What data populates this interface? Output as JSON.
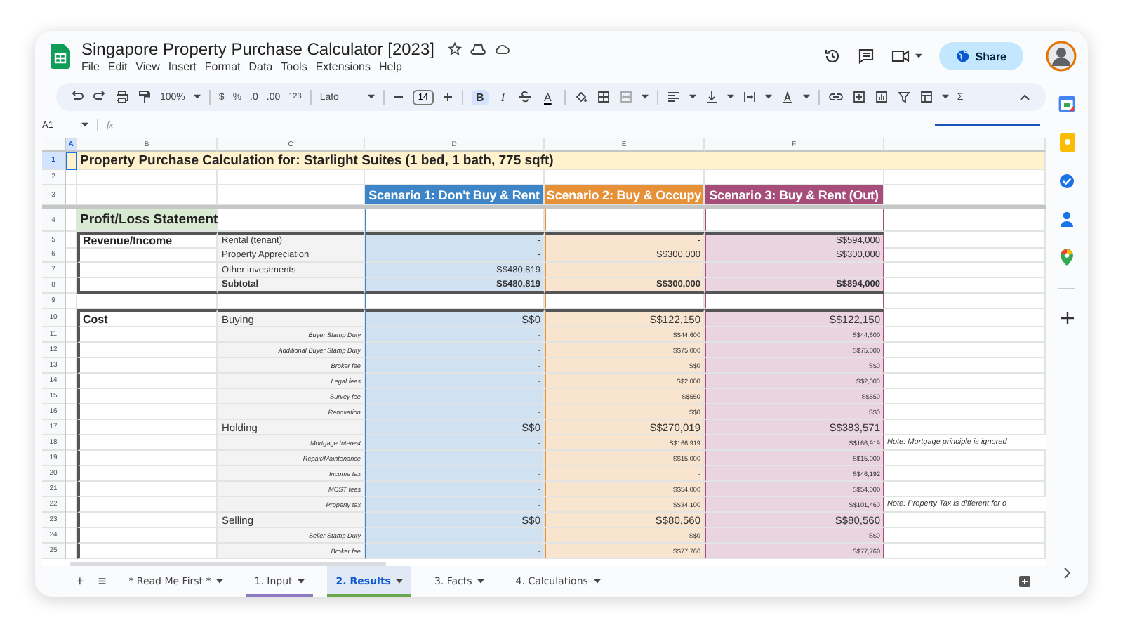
{
  "window": {
    "title": "Singapore Property Purchase Calculator [2023]",
    "share": "Share"
  },
  "menu": [
    "File",
    "Edit",
    "View",
    "Insert",
    "Format",
    "Data",
    "Tools",
    "Extensions",
    "Help"
  ],
  "toolbar": {
    "zoom": "100%",
    "currency": "$",
    "percent": "%",
    "decrease_decimals": ".0",
    "increase_decimals": ".00",
    "number_format": "123",
    "font": "Lato",
    "font_size": "14",
    "bold": "B",
    "bold_active": true,
    "italic": "I",
    "text_color": "A",
    "functions": "Σ"
  },
  "formula_bar": {
    "cell": "A1",
    "fx": "fx"
  },
  "grid": {
    "columns": [
      {
        "label": "A",
        "selected": true
      },
      {
        "label": "B",
        "selected": false
      },
      {
        "label": "C",
        "selected": false
      },
      {
        "label": "D",
        "selected": false
      },
      {
        "label": "E",
        "selected": false
      },
      {
        "label": "F",
        "selected": false
      }
    ],
    "rows": [
      {
        "number": "1",
        "kind": "title",
        "a_selected": true,
        "b": "Property Purchase Calculation for: Starlight Suites (1 bed, 1 bath, 775 sqft)"
      },
      {
        "number": "2",
        "kind": "blank"
      },
      {
        "number": "3",
        "kind": "header",
        "scenarios": [
          {
            "label": "Scenario 1: Don't Buy & Rent",
            "color": "#3d85c6"
          },
          {
            "label": "Scenario 2: Buy & Occupy",
            "color": "#e69138"
          },
          {
            "label": "Scenario 3: Buy & Rent (Out)",
            "color": "#a64d79"
          }
        ]
      },
      {
        "number": "4",
        "kind": "statement",
        "b": "Profit/Loss Statement"
      },
      {
        "number": "5",
        "kind": "line",
        "b": "Revenue/Income",
        "c": "Rental (tenant)",
        "d": "-",
        "e": "-",
        "f": "S$594,000"
      },
      {
        "number": "6",
        "kind": "line",
        "c": "Property Appreciation",
        "d": "-",
        "e": "S$300,000",
        "f": "S$300,000"
      },
      {
        "number": "7",
        "kind": "line",
        "c": "Other investments",
        "d": "S$480,819",
        "e": "-",
        "f": "-"
      },
      {
        "number": "8",
        "kind": "subtotal",
        "c": "Subtotal",
        "d": "S$480,819",
        "e": "S$300,000",
        "f": "S$894,000"
      },
      {
        "number": "9",
        "kind": "gap"
      },
      {
        "number": "10",
        "kind": "section",
        "b": "Cost",
        "c": "Buying",
        "d": "S$0",
        "e": "S$122,150",
        "f": "S$122,150"
      },
      {
        "number": "11",
        "kind": "item",
        "c": "Buyer Stamp Duty",
        "d": "-",
        "e": "S$44,600",
        "f": "S$44,600"
      },
      {
        "number": "12",
        "kind": "item",
        "c": "Additional Buyer Stamp Duty",
        "d": "-",
        "e": "S$75,000",
        "f": "S$75,000"
      },
      {
        "number": "13",
        "kind": "item",
        "c": "Broker fee",
        "d": "-",
        "e": "S$0",
        "f": "S$0"
      },
      {
        "number": "14",
        "kind": "item",
        "c": "Legal fees",
        "d": "-",
        "e": "S$2,000",
        "f": "S$2,000"
      },
      {
        "number": "15",
        "kind": "item",
        "c": "Survey fee",
        "d": "-",
        "e": "S$550",
        "f": "S$550"
      },
      {
        "number": "16",
        "kind": "item",
        "c": "Renovation",
        "d": "-",
        "e": "S$0",
        "f": "S$0"
      },
      {
        "number": "17",
        "kind": "group",
        "c": "Holding",
        "d": "S$0",
        "e": "S$270,019",
        "f": "S$383,571"
      },
      {
        "number": "18",
        "kind": "item",
        "c": "Mortgage Interest",
        "d": "-",
        "e": "S$166,919",
        "f": "S$166,919",
        "g": "Note: Mortgage principle is ignored"
      },
      {
        "number": "19",
        "kind": "item",
        "c": "Repair/Maintenance",
        "d": "-",
        "e": "S$15,000",
        "f": "S$15,000"
      },
      {
        "number": "20",
        "kind": "item",
        "c": "Income tax",
        "d": "-",
        "e": "-",
        "f": "S$46,192"
      },
      {
        "number": "21",
        "kind": "item",
        "c": "MCST fees",
        "d": "-",
        "e": "S$54,000",
        "f": "S$54,000"
      },
      {
        "number": "22",
        "kind": "item",
        "c": "Property tax",
        "d": "-",
        "e": "S$34,100",
        "f": "S$101,460",
        "g": "Note: Property Tax is different for o"
      },
      {
        "number": "23",
        "kind": "group",
        "c": "Selling",
        "d": "S$0",
        "e": "S$80,560",
        "f": "S$80,560"
      },
      {
        "number": "24",
        "kind": "item",
        "c": "Seller Stamp Duty",
        "d": "-",
        "e": "S$0",
        "f": "S$0"
      },
      {
        "number": "25",
        "kind": "item",
        "c": "Broker fee",
        "d": "-",
        "e": "S$77,760",
        "f": "S$77,760"
      }
    ]
  },
  "sheet_tabs": {
    "add": "+",
    "all_sheets": "≡",
    "tabs": [
      {
        "label": "* Read Me First *",
        "selected": false
      },
      {
        "label": "1. Input",
        "selected": false,
        "color": "#8e7cc3"
      },
      {
        "label": "2. Results",
        "selected": true,
        "color": "#6aa84f"
      },
      {
        "label": "3. Facts",
        "selected": false
      },
      {
        "label": "4. Calculations",
        "selected": false
      }
    ]
  }
}
